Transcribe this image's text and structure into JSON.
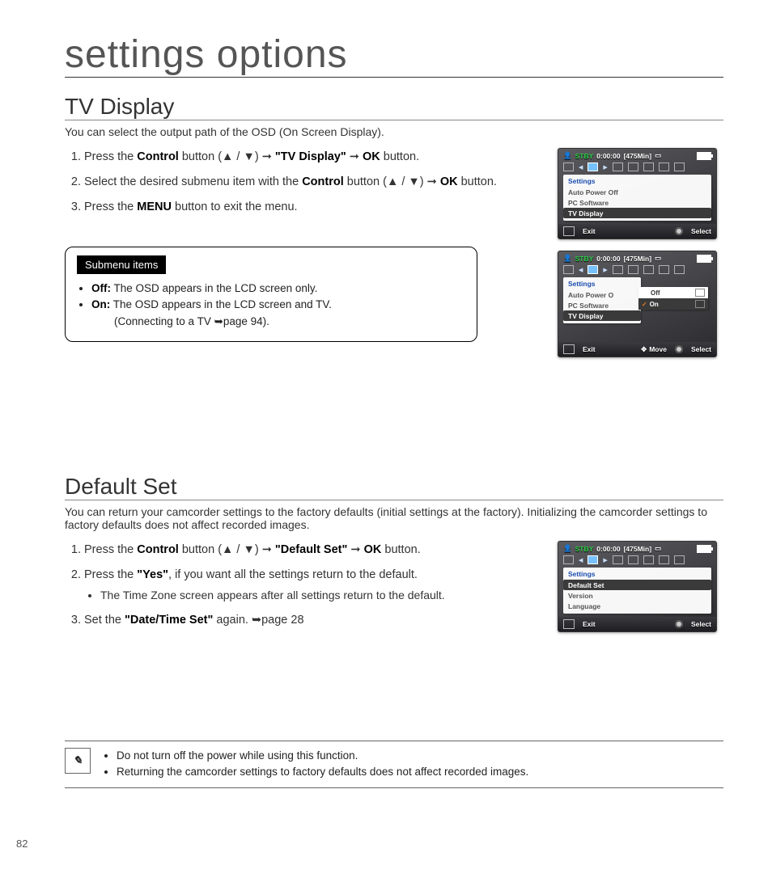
{
  "page_title": "settings options",
  "page_number": "82",
  "tv_display": {
    "heading": "TV Display",
    "lead": "You can select the output path of the OSD (On Screen Display).",
    "step1_a": "Press the ",
    "step1_b": "Control",
    "step1_c": " button (",
    "step1_d": " / ",
    "step1_e": ") ➞ ",
    "step1_f": "\"TV Display\"",
    "step1_g": " ➞ ",
    "step1_h": "OK",
    "step1_i": " button.",
    "step2_a": "Select the desired submenu item with the ",
    "step2_b": "Control",
    "step2_c": " button (",
    "step2_d": " / ",
    "step2_e": ") ➞ ",
    "step2_f": "OK",
    "step2_g": " button.",
    "step3_a": "Press the ",
    "step3_b": "MENU",
    "step3_c": " button to exit the menu.",
    "submenu_title": "Submenu items",
    "off_label": "Off:",
    "off_text": " The OSD appears in the LCD screen only.",
    "on_label": "On:",
    "on_text": " The OSD appears in the LCD screen and TV.",
    "on_note": "(Connecting to a TV ➥page 94)."
  },
  "default_set": {
    "heading": "Default Set",
    "lead": "You can return your camcorder settings to the factory defaults (initial settings at the factory). Initializing the camcorder settings to factory defaults does not affect recorded images.",
    "step1_a": "Press the ",
    "step1_b": "Control",
    "step1_c": " button (",
    "step1_d": " / ",
    "step1_e": ") ➞ ",
    "step1_f": "\"Default Set\"",
    "step1_g": " ➞ ",
    "step1_h": "OK",
    "step1_i": " button.",
    "step2_a": "Press the ",
    "step2_b": "\"Yes\"",
    "step2_c": ", if you want all the settings return to the default.",
    "step2_bullet": "The Time Zone screen appears after all settings return to the default.",
    "step3_a": "Set the ",
    "step3_b": "\"Date/Time Set\"",
    "step3_c": " again. ➥page 28"
  },
  "notes": {
    "n1": "Do not turn off the power while using this function.",
    "n2": "Returning the camcorder settings to factory defaults does not affect recorded images."
  },
  "osd": {
    "stby": "STBY",
    "time": "0:00:00",
    "cap": "[475Min]",
    "settings": "Settings",
    "auto_power_off": "Auto Power Off",
    "pc_software": "PC Software",
    "tv_display": "TV Display",
    "off": "Off",
    "on": "On",
    "exit": "Exit",
    "select": "Select",
    "move": "Move",
    "menu": "MENU",
    "default_set": "Default Set",
    "version": "Version",
    "language": "Language"
  }
}
